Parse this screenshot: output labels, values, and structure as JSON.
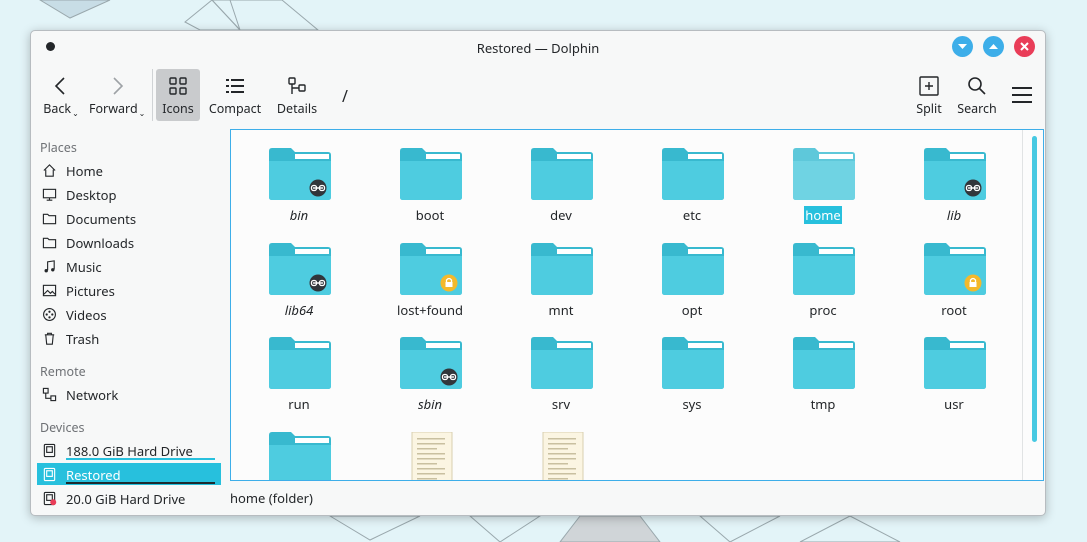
{
  "window": {
    "title": "Restored — Dolphin"
  },
  "toolbar": {
    "back": "Back",
    "forward": "Forward",
    "icons": "Icons",
    "compact": "Compact",
    "details": "Details",
    "path": "/",
    "split": "Split",
    "search": "Search"
  },
  "sidebar": {
    "places_title": "Places",
    "places": [
      {
        "label": "Home",
        "icon": "home-icon"
      },
      {
        "label": "Desktop",
        "icon": "desktop-icon"
      },
      {
        "label": "Documents",
        "icon": "folder-icon"
      },
      {
        "label": "Downloads",
        "icon": "folder-icon"
      },
      {
        "label": "Music",
        "icon": "music-icon"
      },
      {
        "label": "Pictures",
        "icon": "picture-icon"
      },
      {
        "label": "Videos",
        "icon": "video-icon"
      },
      {
        "label": "Trash",
        "icon": "trash-icon"
      }
    ],
    "remote_title": "Remote",
    "remote": [
      {
        "label": "Network",
        "icon": "network-icon"
      }
    ],
    "devices_title": "Devices",
    "devices": [
      {
        "label": "188.0 GiB Hard Drive",
        "icon": "hard-drive-icon",
        "usage": 0.98
      },
      {
        "label": "Restored",
        "icon": "hard-drive-icon",
        "usage": 0.98
      },
      {
        "label": "20.0 GiB Hard Drive",
        "icon": "hard-drive-error-icon"
      }
    ]
  },
  "files": [
    {
      "name": "bin",
      "italic": true,
      "badge": "link"
    },
    {
      "name": "boot"
    },
    {
      "name": "dev"
    },
    {
      "name": "etc"
    },
    {
      "name": "home",
      "selected": true
    },
    {
      "name": "lib",
      "italic": true,
      "badge": "link"
    },
    {
      "name": "lib64",
      "italic": true,
      "badge": "link"
    },
    {
      "name": "lost+found",
      "badge": "lock"
    },
    {
      "name": "mnt"
    },
    {
      "name": "opt"
    },
    {
      "name": "proc"
    },
    {
      "name": "root",
      "badge": "lock"
    },
    {
      "name": "run"
    },
    {
      "name": "sbin",
      "italic": true,
      "badge": "link"
    },
    {
      "name": "srv"
    },
    {
      "name": "sys"
    },
    {
      "name": "tmp"
    },
    {
      "name": "usr"
    },
    {
      "name": "",
      "kind": "folder"
    },
    {
      "name": "",
      "kind": "text-file"
    },
    {
      "name": "",
      "kind": "text-file"
    }
  ],
  "status": {
    "text": "home (folder)"
  },
  "colors": {
    "accent": "#27c0dd",
    "folder": "#4ecce0",
    "close": "#e93d58",
    "window_btn": "#3daee9"
  }
}
